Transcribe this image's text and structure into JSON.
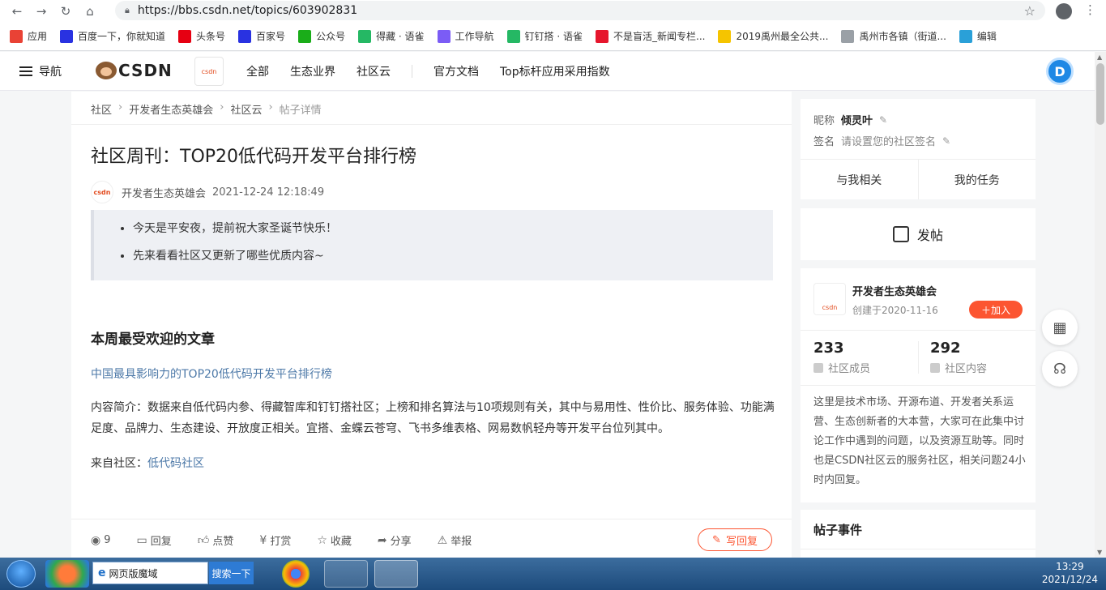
{
  "browser": {
    "url": "https://bbs.csdn.net/topics/603902831",
    "bookmarks": [
      {
        "label": "应用",
        "color": "#e94235"
      },
      {
        "label": "百度一下，你就知道",
        "color": "#2932e1"
      },
      {
        "label": "头条号",
        "color": "#e60012"
      },
      {
        "label": "百家号",
        "color": "#2932e1"
      },
      {
        "label": "公众号",
        "color": "#1aad19"
      },
      {
        "label": "得藏 · 语雀",
        "color": "#25b864"
      },
      {
        "label": "工作导航",
        "color": "#7b5cf5"
      },
      {
        "label": "钉钉搭 · 语雀",
        "color": "#25b864"
      },
      {
        "label": "不是盲活_新闻专栏...",
        "color": "#e6162d"
      },
      {
        "label": "2019禹州最全公共...",
        "color": "#f5c400"
      },
      {
        "label": "禹州市各镇（街道...",
        "color": "#9aa0a6"
      },
      {
        "label": "编辑",
        "color": "#2aa0d8"
      }
    ]
  },
  "header": {
    "nav_label": "导航",
    "logo_text": "CSDN",
    "small_logo_text": "csdn",
    "links": [
      "全部",
      "生态业界",
      "社区云",
      "官方文档",
      "Top标杆应用采用指数"
    ],
    "right_icon": "D"
  },
  "article": {
    "breadcrumb": [
      "社区",
      "开发者生态英雄会",
      "社区云",
      "帖子详情"
    ],
    "title": "社区周刊：TOP20低代码开发平台排行榜",
    "author": "开发者生态英雄会",
    "author_avatar_text": "csdn",
    "date": "2021-12-24 12:18:49",
    "quote_items": [
      "今天是平安夜，提前祝大家圣诞节快乐！",
      "先来看看社区又更新了哪些优质内容~"
    ],
    "section_heading": "本周最受欢迎的文章",
    "link_title": "中国最具影响力的TOP20低代码开发平台排行榜",
    "paragraph": "内容简介：数据来自低代码内参、得藏智库和钉钉搭社区；上榜和排名算法与10项规则有关，其中与易用性、性价比、服务体验、功能满足度、品牌力、生态建设、开放度正相关。宜搭、金蝶云苍穹、飞书多维表格、网易数帆轻舟等开发平台位列其中。",
    "from_label": "来自社区：",
    "from_link": "低代码社区"
  },
  "actions": {
    "views": "9",
    "reply": "回复",
    "like": "点赞",
    "reward": "打赏",
    "collect": "收藏",
    "share": "分享",
    "report": "举报",
    "write_reply": "写回复"
  },
  "sidebar": {
    "nickname_label": "昵称",
    "nickname": "倾灵叶",
    "signature_label": "签名",
    "signature_hint": "请设置您的社区签名",
    "tab_related": "与我相关",
    "tab_tasks": "我的任务",
    "post_label": "发帖",
    "community": {
      "name": "开发者生态英雄会",
      "logo_text": "csdn",
      "created": "创建于2020-11-16",
      "join_label": "＋加入",
      "members_count": "233",
      "members_label": "社区成员",
      "content_count": "292",
      "content_label": "社区内容",
      "description": "这里是技术市场、开源布道、开发者关系运营、生态创新者的大本营，大家可在此集中讨论工作中遇到的问题，以及资源互助等。同时也是CSDN社区云的服务社区，相关问题24小时内回复。"
    },
    "events_heading": "帖子事件"
  },
  "taskbar": {
    "search_label": "网页版魔域",
    "search_button": "搜索一下",
    "time": "13:29",
    "date": "2021/12/24"
  }
}
